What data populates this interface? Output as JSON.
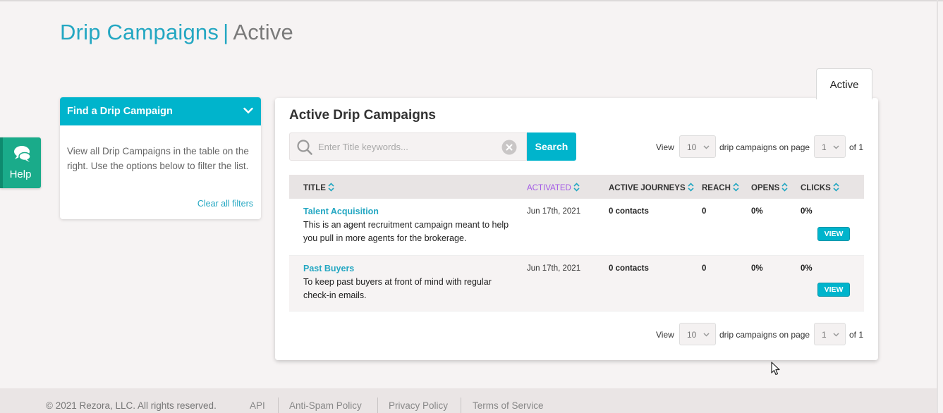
{
  "header": {
    "title_primary": "Drip Campaigns",
    "separator": "|",
    "title_secondary": "Active"
  },
  "help_widget": {
    "label": "Help",
    "icon": "chat-bubbles-icon"
  },
  "find_panel": {
    "title": "Find a Drip Campaign",
    "description": "View all Drip Campaigns in the table on the right. Use the options below to filter the list.",
    "clear_filters": "Clear all filters"
  },
  "tabs": [
    {
      "label": "Active",
      "selected": true
    }
  ],
  "campaigns_panel": {
    "title": "Active Drip Campaigns",
    "search": {
      "placeholder": "Enter Title keywords...",
      "value": "",
      "button_label": "Search"
    },
    "pager": {
      "view_label": "View",
      "per_page": "10",
      "middle_label": "drip campaigns on page",
      "page": "1",
      "of_label": "of 1"
    },
    "columns": [
      "TITLE",
      "ACTIVATED",
      "ACTIVE JOURNEYS",
      "REACH",
      "OPENS",
      "CLICKS"
    ],
    "sorted_column": "ACTIVATED",
    "rows": [
      {
        "title": "Talent Acquisition",
        "description": "This is an agent recruitment campaign meant to help you pull in more agents for the brokerage.",
        "activated": "Jun 17th, 2021",
        "active_journeys": "0 contacts",
        "reach": "0",
        "opens": "0%",
        "clicks": "0%",
        "action": "VIEW"
      },
      {
        "title": "Past Buyers",
        "description": "To keep past buyers at front of mind with regular check-in emails.",
        "activated": "Jun 17th, 2021",
        "active_journeys": "0 contacts",
        "reach": "0",
        "opens": "0%",
        "clicks": "0%",
        "action": "VIEW"
      }
    ]
  },
  "footer": {
    "copyright": "© 2021 Rezora, LLC. All rights reserved.",
    "links": [
      "API",
      "Anti-Spam Policy",
      "Privacy Policy",
      "Terms of Service"
    ]
  },
  "colors": {
    "accent": "#00b4cc",
    "link": "#24a7c2",
    "help": "#1aab8a",
    "sorted": "#a259e6"
  }
}
